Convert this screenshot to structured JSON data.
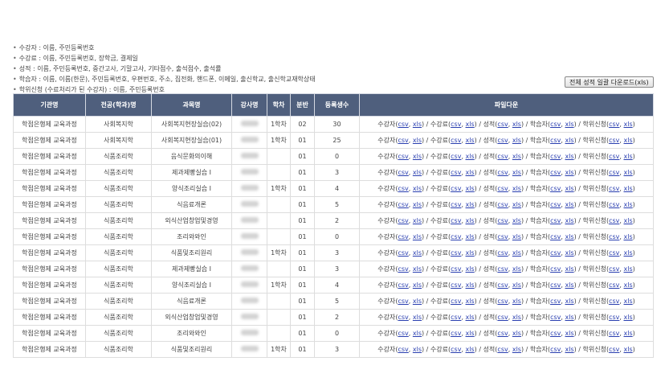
{
  "notes": [
    "수강자 : 이름, 주민등록번호",
    "수강료 : 이름, 주민등록번호, 장학금, 결제일",
    "성적 : 이름, 주민등록번호, 중간고사, 기말고사, 기타점수, 출석점수, 출석률",
    "학습자 : 이름, 이름(한문), 주민등록번호, 우편번호, 주소, 집전화, 핸드폰, 이메일, 출신학교, 출신학교재학상태",
    "학위신청 (수료처리가 된 수강자) : 이름, 주민등록번호"
  ],
  "download_all_label": "전체 성적 일괄 다운로드(xls)",
  "headers": [
    "기관명",
    "전공(학과)명",
    "과목명",
    "강사명",
    "학차",
    "분반",
    "등록생수",
    "파일다운"
  ],
  "file_labels": {
    "students": "수강자",
    "fees": "수강료",
    "grades": "성적",
    "learners": "학습자",
    "degree": "학위신청",
    "csv": "csv",
    "xls": "xls"
  },
  "rows": [
    {
      "org": "학점은행제 교육과정",
      "major": "사회복지학",
      "subject": "사회복지현장실습(02)",
      "term": "1학차",
      "section": "02",
      "count": "30"
    },
    {
      "org": "학점은행제 교육과정",
      "major": "사회복지학",
      "subject": "사회복지현장실습(01)",
      "term": "1학차",
      "section": "01",
      "count": "25"
    },
    {
      "org": "학점은행제 교육과정",
      "major": "식품조리학",
      "subject": "음식문화의이해",
      "term": "",
      "section": "01",
      "count": "0"
    },
    {
      "org": "학점은행제 교육과정",
      "major": "식품조리학",
      "subject": "제과제빵실습 I",
      "term": "",
      "section": "01",
      "count": "3"
    },
    {
      "org": "학점은행제 교육과정",
      "major": "식품조리학",
      "subject": "양식조리실습 I",
      "term": "1학차",
      "section": "01",
      "count": "4"
    },
    {
      "org": "학점은행제 교육과정",
      "major": "식품조리학",
      "subject": "식음료개론",
      "term": "",
      "section": "01",
      "count": "5"
    },
    {
      "org": "학점은행제 교육과정",
      "major": "식품조리학",
      "subject": "외식산업창업및경영",
      "term": "",
      "section": "01",
      "count": "2"
    },
    {
      "org": "학점은행제 교육과정",
      "major": "식품조리학",
      "subject": "조리와와인",
      "term": "",
      "section": "01",
      "count": "0"
    },
    {
      "org": "학점은행제 교육과정",
      "major": "식품조리학",
      "subject": "식품및조리원리",
      "term": "1학차",
      "section": "01",
      "count": "3"
    },
    {
      "org": "학점은행제 교육과정",
      "major": "식품조리학",
      "subject": "제과제빵실습 I",
      "term": "",
      "section": "01",
      "count": "3"
    },
    {
      "org": "학점은행제 교육과정",
      "major": "식품조리학",
      "subject": "양식조리실습 I",
      "term": "1학차",
      "section": "01",
      "count": "4"
    },
    {
      "org": "학점은행제 교육과정",
      "major": "식품조리학",
      "subject": "식음료개론",
      "term": "",
      "section": "01",
      "count": "5"
    },
    {
      "org": "학점은행제 교육과정",
      "major": "식품조리학",
      "subject": "외식산업창업및경영",
      "term": "",
      "section": "01",
      "count": "2"
    },
    {
      "org": "학점은행제 교육과정",
      "major": "식품조리학",
      "subject": "조리와와인",
      "term": "",
      "section": "01",
      "count": "0"
    },
    {
      "org": "학점은행제 교육과정",
      "major": "식품조리학",
      "subject": "식품및조리원리",
      "term": "1학차",
      "section": "01",
      "count": "3"
    }
  ]
}
